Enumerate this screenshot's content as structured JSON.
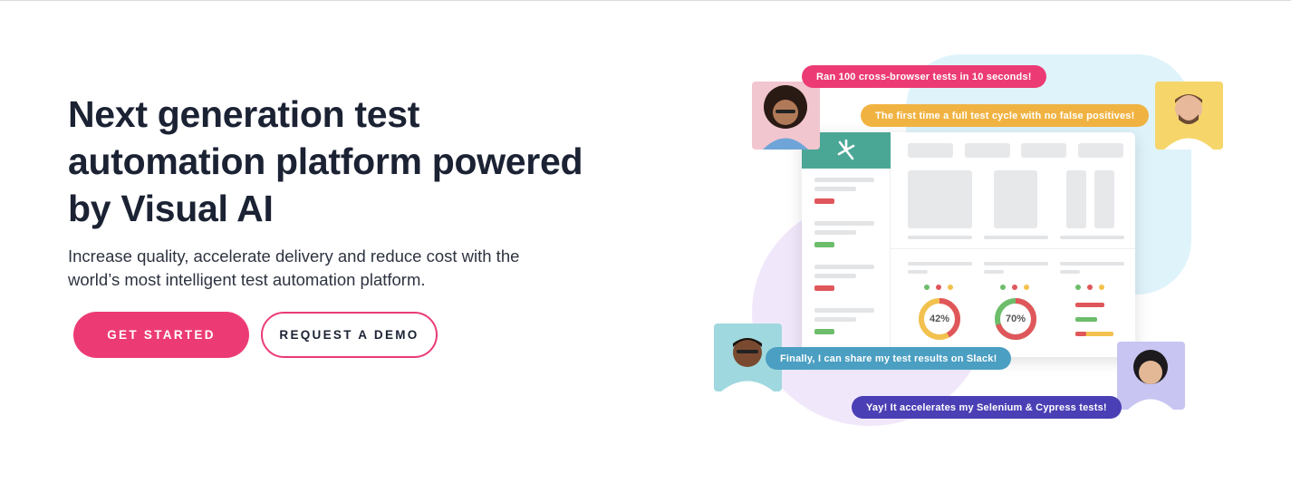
{
  "hero": {
    "title": "Next generation test automation platform powered by Visual AI",
    "subtitle": "Increase quality, accelerate delivery and reduce cost with the world’s most intelligent test automation platform."
  },
  "cta": {
    "primary_label": "GET STARTED",
    "secondary_label": "REQUEST A DEMO"
  },
  "illustration": {
    "bubbles": [
      "Ran 100 cross-browser tests in 10 seconds!",
      "The first time a full test cycle with no false positives!",
      "Finally, I can share my test results on Slack!",
      "Yay! It accelerates my Selenium & Cypress tests!"
    ],
    "donuts": [
      {
        "label": "42%",
        "value": 0.42
      },
      {
        "label": "70%",
        "value": 0.7
      }
    ]
  },
  "colors": {
    "accent": "#ec3b74",
    "brand_green": "#4aa796",
    "bubble_yellow": "#f0b342",
    "bubble_blue": "#4a9fc2",
    "bubble_purple": "#4a3fb4"
  },
  "icons": [
    "applitools-logo-icon"
  ]
}
